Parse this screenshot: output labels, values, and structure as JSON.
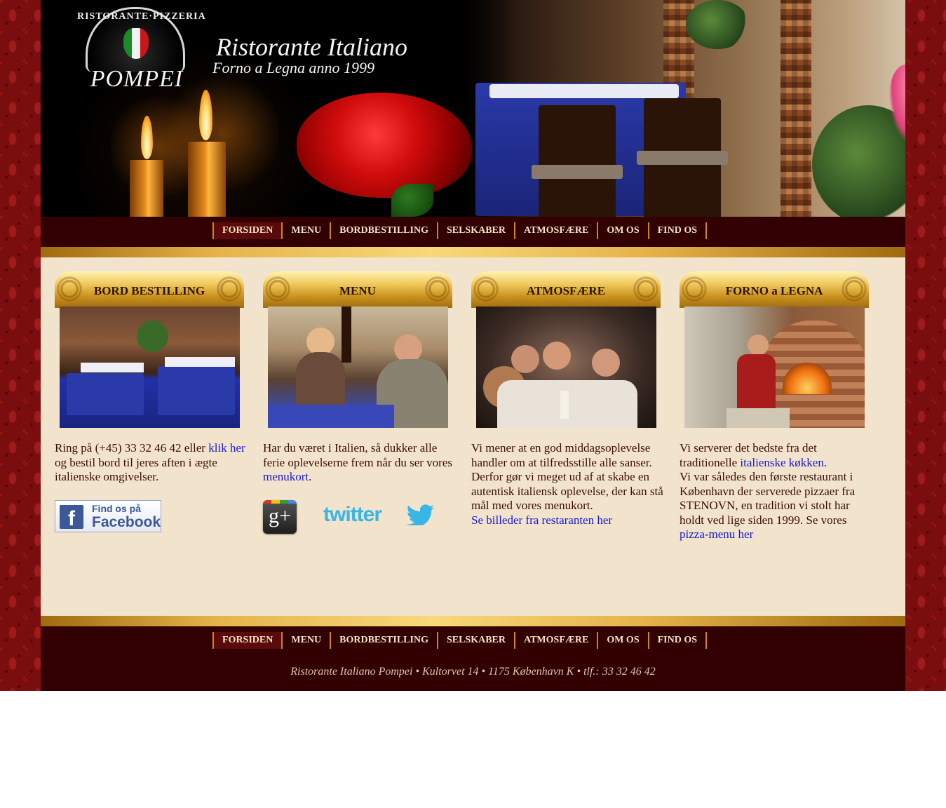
{
  "header": {
    "logo_arc": "RISTORANTE·PIZZERIA",
    "logo_name": "POMPEI",
    "title": "Ristorante Italiano",
    "subtitle": "Forno a Legna anno 1999"
  },
  "nav": {
    "items": [
      {
        "label": "FORSIDEN",
        "active": true
      },
      {
        "label": "MENU"
      },
      {
        "label": "BORDBESTILLING"
      },
      {
        "label": "SELSKABER"
      },
      {
        "label": "ATMOSFÆRE"
      },
      {
        "label": "OM OS"
      },
      {
        "label": "FIND OS"
      }
    ]
  },
  "columns": [
    {
      "heading": "BORD BESTILLING",
      "text_before": "Ring på (+45) 33 32 46 42 eller ",
      "link": "klik her",
      "text_after": " og bestil bord til jeres aften i ægte italienske omgivelser."
    },
    {
      "heading": "MENU",
      "text_before": "Har du været i Italien, så dukker alle ferie oplevelserne frem når du ser vores ",
      "link": "menukort",
      "text_after": "."
    },
    {
      "heading": "ATMOSFÆRE",
      "text_before": "Vi mener at en god middagsoplevelse handler om at tilfredsstille alle sanser.",
      "text_mid": "Derfor gør vi meget ud af at skabe en autentisk italiensk oplevelse, der kan stå mål med vores menukort.",
      "link": "Se billeder fra restaranten her"
    },
    {
      "heading": "FORNO a LEGNA",
      "text_before": "Vi serverer det bedste fra det traditionelle ",
      "link": "italienske køkken",
      "text_after": ".",
      "text_mid": "Vi var således den første restaurant i København der serverede pizzaer fra STENOVN, en tradition vi stolt har holdt ved lige siden 1999. Se vores ",
      "link2": "pizza-menu her"
    }
  ],
  "social": {
    "facebook_small": "Find os på",
    "facebook_big": "Facebook",
    "gplus": "g+",
    "twitter": "twitter"
  },
  "footer": {
    "text": "Ristorante Italiano Pompei • Kultorvet 14 • 1175 København K • tlf.: 33 32 46 42"
  },
  "colors": {
    "nav_bg": "#320000",
    "content_bg": "#f2e4cc",
    "link": "#1a1acc",
    "gold": "#e5b24a"
  }
}
